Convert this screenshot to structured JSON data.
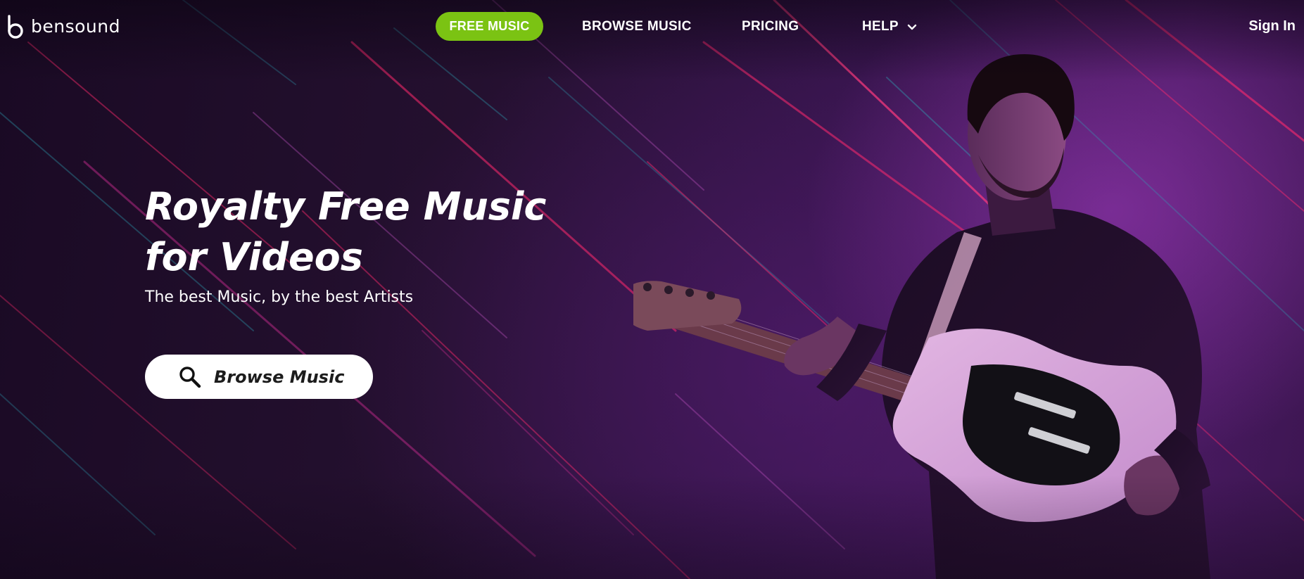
{
  "brand": {
    "name": "bensound",
    "logo_icon": "bensound-b-logo"
  },
  "nav": {
    "items": [
      {
        "label": "FREE MUSIC",
        "active": true
      },
      {
        "label": "BROWSE MUSIC",
        "active": false
      },
      {
        "label": "PRICING",
        "active": false
      },
      {
        "label": "HELP",
        "active": false,
        "icon": "chevron-down-icon"
      }
    ],
    "sign_in": "Sign In"
  },
  "hero": {
    "title_line1": "Royalty Free Music",
    "title_line2": "for Videos",
    "subtitle": "The best Music, by the best Artists",
    "cta_label": "Browse Music",
    "cta_icon": "search-icon",
    "image": "guitarist-playing-electric-guitar"
  },
  "colors": {
    "accent_green": "#7bc313",
    "background_purple": "#2a1038",
    "streak_pink": "#ff2a6d",
    "streak_teal": "#2fa7b8",
    "text_white": "#ffffff",
    "button_bg": "#ffffff",
    "button_text": "#1c1c1c"
  }
}
